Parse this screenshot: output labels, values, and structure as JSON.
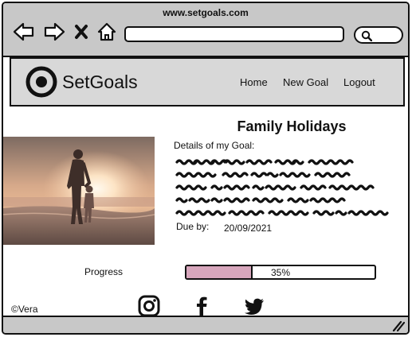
{
  "browser": {
    "url": "www.setgoals.com",
    "icons": [
      "back-arrow-icon",
      "forward-arrow-icon",
      "close-x-icon",
      "home-icon",
      "search-icon"
    ]
  },
  "site": {
    "brand": "SetGoals",
    "nav": [
      "Home",
      "New Goal",
      "Logout"
    ]
  },
  "goal": {
    "title": "Family Holidays",
    "details_label": "Details of my Goal:",
    "due_label": "Due by:",
    "due_date": "20/09/2021",
    "progress_label": "Progress",
    "progress_percent": 35,
    "progress_text": "35%",
    "progress_color": "#d7a6bc"
  },
  "footer": {
    "copyright": "©Vera",
    "social": [
      "instagram-icon",
      "facebook-icon",
      "twitter-icon"
    ]
  }
}
